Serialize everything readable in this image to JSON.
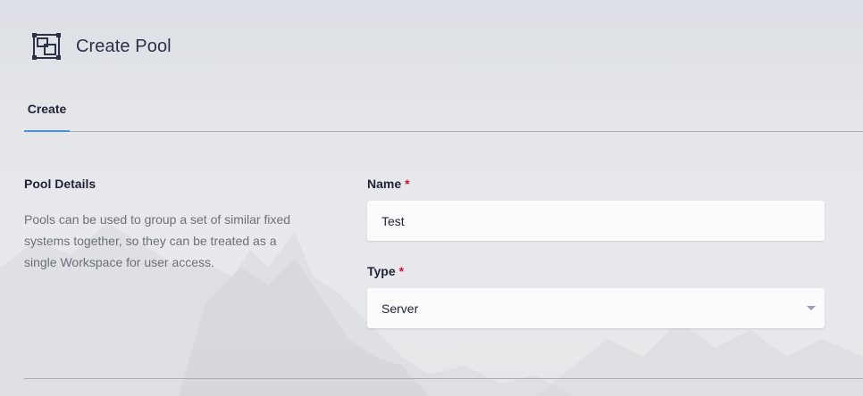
{
  "header": {
    "title": "Create Pool",
    "icon": "pool-icon"
  },
  "tabs": [
    {
      "label": "Create",
      "active": true
    }
  ],
  "section": {
    "title": "Pool Details",
    "description": "Pools can be used to group a set of similar fixed systems together, so they can be treated as a single Workspace for user access."
  },
  "form": {
    "name": {
      "label": "Name",
      "required_mark": "*",
      "value": "Test"
    },
    "type": {
      "label": "Type",
      "required_mark": "*",
      "value": "Server"
    }
  },
  "colors": {
    "accent": "#4a90e2",
    "required": "#c3163a",
    "text": "#1f2433",
    "muted": "#6a707c"
  }
}
